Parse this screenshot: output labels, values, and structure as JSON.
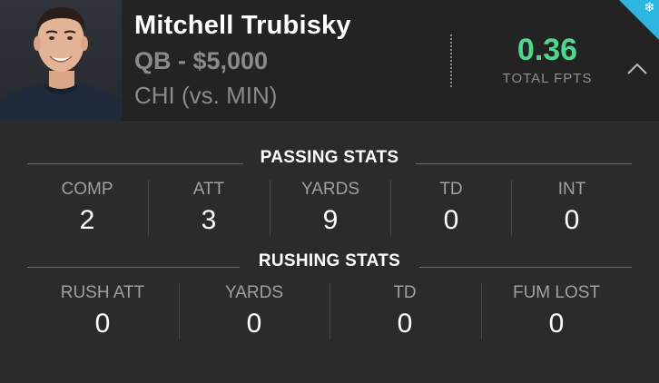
{
  "player": {
    "name": "Mitchell Trubisky",
    "position_salary": "QB - $5,000",
    "matchup": "CHI (vs. MIN)"
  },
  "fpts": {
    "value": "0.36",
    "label": "TOTAL FPTS",
    "value_color": "#4cd98f"
  },
  "icons": {
    "collapse": "chevron-up-icon",
    "badge": "snowflake-icon",
    "badge_color": "#2fb6e0"
  },
  "passing": {
    "title": "PASSING STATS",
    "stats": [
      {
        "label": "COMP",
        "value": "2"
      },
      {
        "label": "ATT",
        "value": "3"
      },
      {
        "label": "YARDS",
        "value": "9"
      },
      {
        "label": "TD",
        "value": "0"
      },
      {
        "label": "INT",
        "value": "0"
      }
    ]
  },
  "rushing": {
    "title": "RUSHING STATS",
    "stats": [
      {
        "label": "RUSH ATT",
        "value": "0"
      },
      {
        "label": "YARDS",
        "value": "0"
      },
      {
        "label": "TD",
        "value": "0"
      },
      {
        "label": "FUM LOST",
        "value": "0"
      }
    ]
  }
}
